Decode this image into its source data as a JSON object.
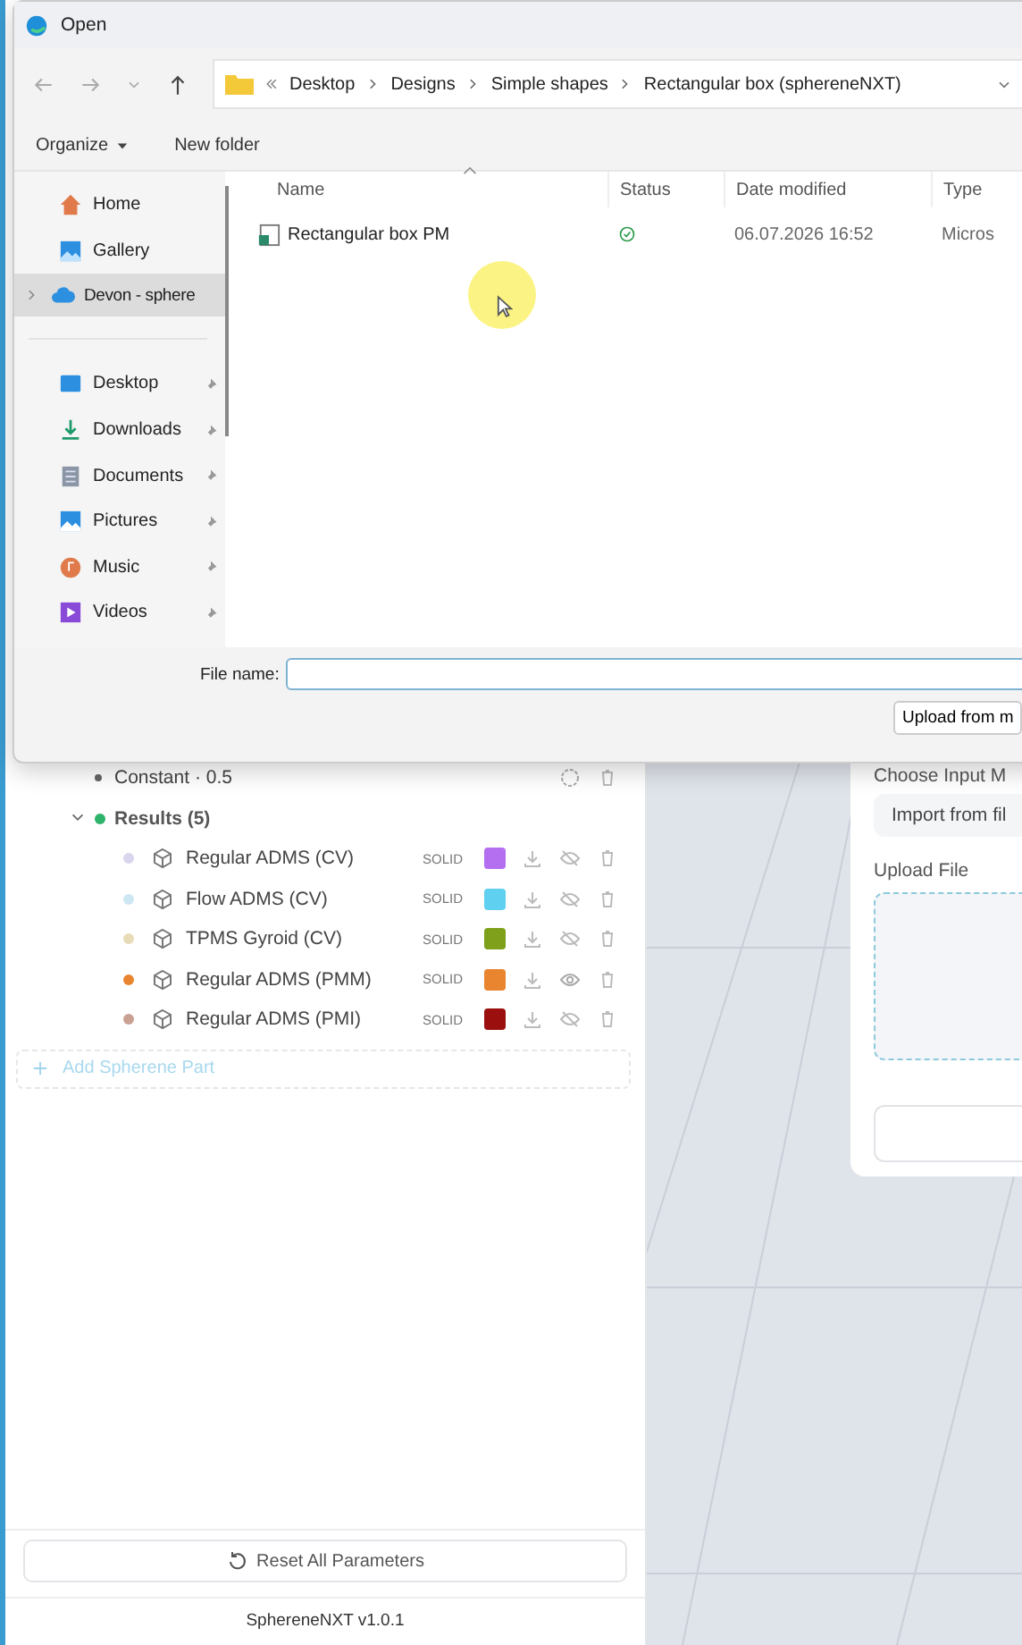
{
  "dialog": {
    "title": "Open",
    "breadcrumbs": [
      "Desktop",
      "Designs",
      "Simple shapes",
      "Rectangular box (sphereneNXT)"
    ],
    "toolbar": {
      "organize": "Organize",
      "new_folder": "New folder"
    },
    "nav_top": [
      {
        "label": "Home",
        "selected": false,
        "expandable": false
      },
      {
        "label": "Gallery",
        "selected": false,
        "expandable": false
      },
      {
        "label": "Devon - sphere",
        "selected": true,
        "expandable": true
      }
    ],
    "quick_access": [
      {
        "label": "Desktop",
        "pinned": true
      },
      {
        "label": "Downloads",
        "pinned": true
      },
      {
        "label": "Documents",
        "pinned": true
      },
      {
        "label": "Pictures",
        "pinned": true
      },
      {
        "label": "Music",
        "pinned": true
      },
      {
        "label": "Videos",
        "pinned": true
      }
    ],
    "columns": [
      "Name",
      "Status",
      "Date modified",
      "Type"
    ],
    "files": [
      {
        "name": "Rectangular box PM",
        "synced": true,
        "date": "06.07.2026 16:52",
        "type": "Micros"
      }
    ],
    "file_name_label": "File name:",
    "upload_button": "Upload from m"
  },
  "tree": {
    "constant": "Constant · 0.5",
    "results": {
      "label": "Results (5)",
      "expanded": true,
      "children": [
        {
          "name": "Regular ADMS (CV)",
          "color": "#d9d5ec",
          "mode": "SOLID",
          "swatch": {
            "color": "#b46ef0"
          },
          "visible": false
        },
        {
          "name": "Flow ADMS (CV)",
          "color": "#cde8f3",
          "mode": "SOLID",
          "swatch": {
            "color": "#5fd0f0"
          },
          "visible": false
        },
        {
          "name": "TPMS Gyroid (CV)",
          "color": "#e7dbb8",
          "mode": "SOLID",
          "swatch": {
            "color": "#7ea01a"
          },
          "visible": false
        },
        {
          "name": "Regular ADMS (PMM)",
          "color": "#e8852e",
          "mode": "SOLID",
          "swatch": {
            "color": "#e8852e"
          },
          "visible": true
        },
        {
          "name": "Regular ADMS (PMI)",
          "color": "#c9a092",
          "mode": "SOLID",
          "swatch": {
            "color": "#9b0f0f"
          },
          "visible": false
        }
      ]
    }
  },
  "add_part": "Add Spherene Part",
  "reset": "Reset All Parameters",
  "version": "SphereneNXT v1.0.1",
  "input_panel": {
    "heading": "Choose Input M",
    "method": "Import from fil",
    "upload_label": "Upload File"
  }
}
